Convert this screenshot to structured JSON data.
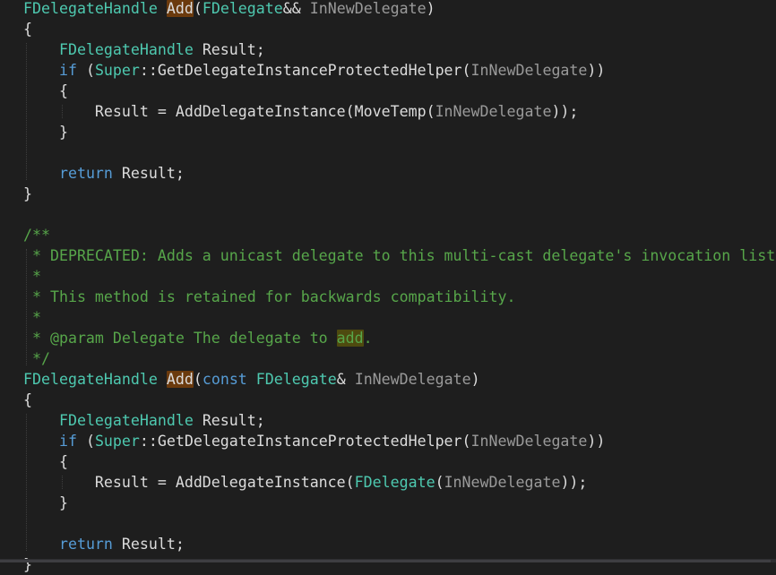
{
  "editor": {
    "colors": {
      "background": "#1e1e1e",
      "plain": "#dcdcdc",
      "type": "#4ec9b0",
      "keyword": "#569cd6",
      "parameter": "#9a9a9a",
      "comment": "#57a64a",
      "reference_highlight": "#6b3a0d"
    },
    "lines": [
      [
        {
          "t": "FDelegateHandle",
          "k": "type"
        },
        {
          "t": " "
        },
        {
          "t": "Add",
          "k": "plain",
          "hl": "ref"
        },
        {
          "t": "("
        },
        {
          "t": "FDelegate",
          "k": "type"
        },
        {
          "t": "&& "
        },
        {
          "t": "InNewDelegate",
          "k": "param"
        },
        {
          "t": ")"
        }
      ],
      [
        {
          "t": "{"
        }
      ],
      [
        {
          "t": "    "
        },
        {
          "t": "FDelegateHandle",
          "k": "type"
        },
        {
          "t": " Result;"
        }
      ],
      [
        {
          "t": "    "
        },
        {
          "t": "if",
          "k": "kw"
        },
        {
          "t": " ("
        },
        {
          "t": "Super",
          "k": "type"
        },
        {
          "t": "::GetDelegateInstanceProtectedHelper("
        },
        {
          "t": "InNewDelegate",
          "k": "param"
        },
        {
          "t": "))"
        }
      ],
      [
        {
          "t": "    {"
        }
      ],
      [
        {
          "t": "        Result = AddDelegateInstance(MoveTemp("
        },
        {
          "t": "InNewDelegate",
          "k": "param"
        },
        {
          "t": "));"
        }
      ],
      [
        {
          "t": "    }"
        }
      ],
      [],
      [
        {
          "t": "    "
        },
        {
          "t": "return",
          "k": "kw"
        },
        {
          "t": " Result;"
        }
      ],
      [
        {
          "t": "}"
        }
      ],
      [],
      [
        {
          "t": "/**",
          "k": "comment"
        }
      ],
      [
        {
          "t": " * DEPRECATED: Adds a unicast delegate to this multi-cast delegate's invocation list.",
          "k": "comment"
        }
      ],
      [
        {
          "t": " *",
          "k": "comment"
        }
      ],
      [
        {
          "t": " * This method is retained for backwards compatibility.",
          "k": "comment"
        }
      ],
      [
        {
          "t": " *",
          "k": "comment"
        }
      ],
      [
        {
          "t": " * @param Delegate The delegate to ",
          "k": "comment"
        },
        {
          "t": "add",
          "k": "comment",
          "hl": "ref-comment"
        },
        {
          "t": ".",
          "k": "comment"
        }
      ],
      [
        {
          "t": " */",
          "k": "comment"
        }
      ],
      [
        {
          "t": "FDelegateHandle",
          "k": "type"
        },
        {
          "t": " "
        },
        {
          "t": "Add",
          "k": "plain",
          "hl": "ref"
        },
        {
          "t": "("
        },
        {
          "t": "const",
          "k": "kw"
        },
        {
          "t": " "
        },
        {
          "t": "FDelegate",
          "k": "type"
        },
        {
          "t": "& "
        },
        {
          "t": "InNewDelegate",
          "k": "param"
        },
        {
          "t": ")"
        }
      ],
      [
        {
          "t": "{"
        }
      ],
      [
        {
          "t": "    "
        },
        {
          "t": "FDelegateHandle",
          "k": "type"
        },
        {
          "t": " Result;"
        }
      ],
      [
        {
          "t": "    "
        },
        {
          "t": "if",
          "k": "kw"
        },
        {
          "t": " ("
        },
        {
          "t": "Super",
          "k": "type"
        },
        {
          "t": "::GetDelegateInstanceProtectedHelper("
        },
        {
          "t": "InNewDelegate",
          "k": "param"
        },
        {
          "t": "))"
        }
      ],
      [
        {
          "t": "    {"
        }
      ],
      [
        {
          "t": "        Result = AddDelegateInstance("
        },
        {
          "t": "FDelegate",
          "k": "type"
        },
        {
          "t": "("
        },
        {
          "t": "InNewDelegate",
          "k": "param"
        },
        {
          "t": "));"
        }
      ],
      [
        {
          "t": "    }"
        }
      ],
      [],
      [
        {
          "t": "    "
        },
        {
          "t": "return",
          "k": "kw"
        },
        {
          "t": " Result;"
        }
      ],
      [
        {
          "t": "}"
        }
      ]
    ]
  }
}
